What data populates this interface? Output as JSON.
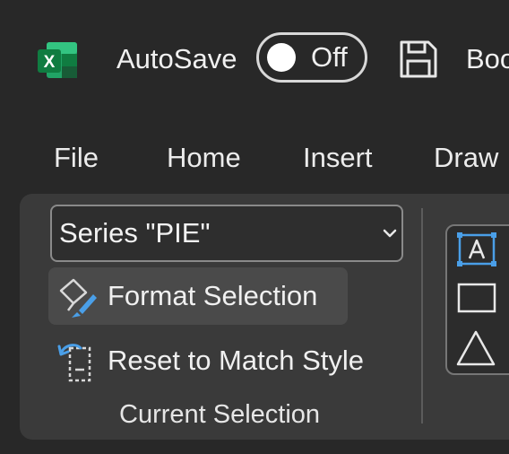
{
  "titlebar": {
    "app_icon": "excel-icon",
    "app_icon_letter": "X",
    "autosave_label": "AutoSave",
    "autosave_state": "Off",
    "save_icon": "save-icon",
    "document_name": "Boo"
  },
  "tabs": [
    {
      "label": "File"
    },
    {
      "label": "Home"
    },
    {
      "label": "Insert"
    },
    {
      "label": "Draw"
    }
  ],
  "current_selection": {
    "selector_value": "Series \"PIE\"",
    "format_selection_label": "Format Selection",
    "reset_label": "Reset to Match Style",
    "group_label": "Current Selection"
  },
  "shapes": {
    "items": [
      "text-box-icon",
      "rectangle-icon",
      "triangle-icon"
    ]
  },
  "colors": {
    "background": "#282828",
    "ribbon": "#3a3a3a",
    "accent_blue": "#4a9fe8",
    "excel_green": "#1f7a45"
  }
}
